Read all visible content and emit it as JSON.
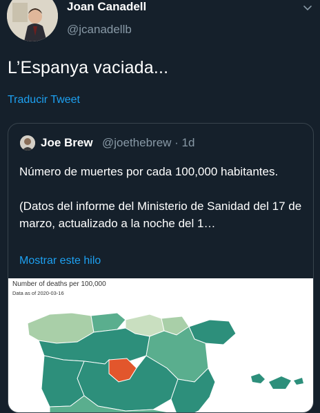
{
  "tweet": {
    "author_name": "Joan Canadell",
    "author_handle": "@jcanadellb",
    "text": "L’Espanya vaciada...",
    "translate_label": "Traducir Tweet"
  },
  "quoted": {
    "author_name": "Joe Brew",
    "meta": "@joethebrew · 1d",
    "text_line1": "Número de muertes por cada 100,000 habitantes.",
    "text_line2": "(Datos del informe del Ministerio de Sanidad del 17 de marzo, actualizado a la noche del 1…",
    "show_thread_label": "Mostrar este hilo"
  },
  "map": {
    "title": "Number of deaths per 100,000",
    "subtitle": "Data as of 2020-03-16",
    "colors": {
      "dark": "#2d8f7b",
      "medium": "#5aae8e",
      "light": "#a9cfa8",
      "pale": "#c9dfc0",
      "madrid": "#e2562c"
    }
  },
  "colors": {
    "background": "#15202b",
    "border": "#38444d",
    "link": "#1da1f2",
    "secondary_text": "#8899a6"
  }
}
